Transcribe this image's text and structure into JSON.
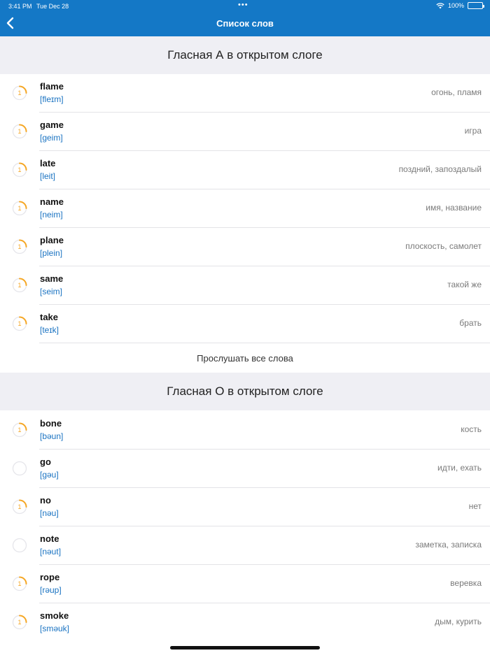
{
  "status_bar": {
    "time": "3:41 PM",
    "date": "Tue Dec 28",
    "dots": "•••",
    "battery": "100%"
  },
  "nav": {
    "title": "Список слов",
    "back_icon": "chevron-left-icon"
  },
  "sections": [
    {
      "title": "Гласная А в открытом слоге",
      "listen_all": "Прослушать все слова",
      "words": [
        {
          "word": "flame",
          "transcription": "[fleɪm]",
          "meaning": "огонь, пламя",
          "level": "1",
          "progress": 0.25
        },
        {
          "word": "game",
          "transcription": "[geim]",
          "meaning": "игра",
          "level": "1",
          "progress": 0.25
        },
        {
          "word": "late",
          "transcription": "[leit]",
          "meaning": "поздний, запоздалый",
          "level": "1",
          "progress": 0.25
        },
        {
          "word": "name",
          "transcription": "[neim]",
          "meaning": "имя, название",
          "level": "1",
          "progress": 0.25
        },
        {
          "word": "plane",
          "transcription": "[plein]",
          "meaning": "плоскость, самолет",
          "level": "1",
          "progress": 0.25
        },
        {
          "word": "same",
          "transcription": "[seim]",
          "meaning": "такой же",
          "level": "1",
          "progress": 0.25
        },
        {
          "word": "take",
          "transcription": "[teɪk]",
          "meaning": "брать",
          "level": "1",
          "progress": 0.25
        }
      ]
    },
    {
      "title": "Гласная О в открытом слоге",
      "words": [
        {
          "word": "bone",
          "transcription": "[bəun]",
          "meaning": "кость",
          "level": "1",
          "progress": 0.25
        },
        {
          "word": "go",
          "transcription": "[gəu]",
          "meaning": "идти, ехать",
          "level": "",
          "progress": 0
        },
        {
          "word": "no",
          "transcription": "[nəu]",
          "meaning": "нет",
          "level": "1",
          "progress": 0.25
        },
        {
          "word": "note",
          "transcription": "[nəut]",
          "meaning": "заметка, записка",
          "level": "",
          "progress": 0
        },
        {
          "word": "rope",
          "transcription": "[rəup]",
          "meaning": "веревка",
          "level": "1",
          "progress": 0.25
        },
        {
          "word": "smoke",
          "transcription": "[sməuk]",
          "meaning": "дым, курить",
          "level": "1",
          "progress": 0.25
        }
      ]
    }
  ],
  "colors": {
    "accent": "#1478c6",
    "progress": "#f5a623",
    "ring": "#e5e5ea",
    "transcription": "#1a73c2"
  }
}
